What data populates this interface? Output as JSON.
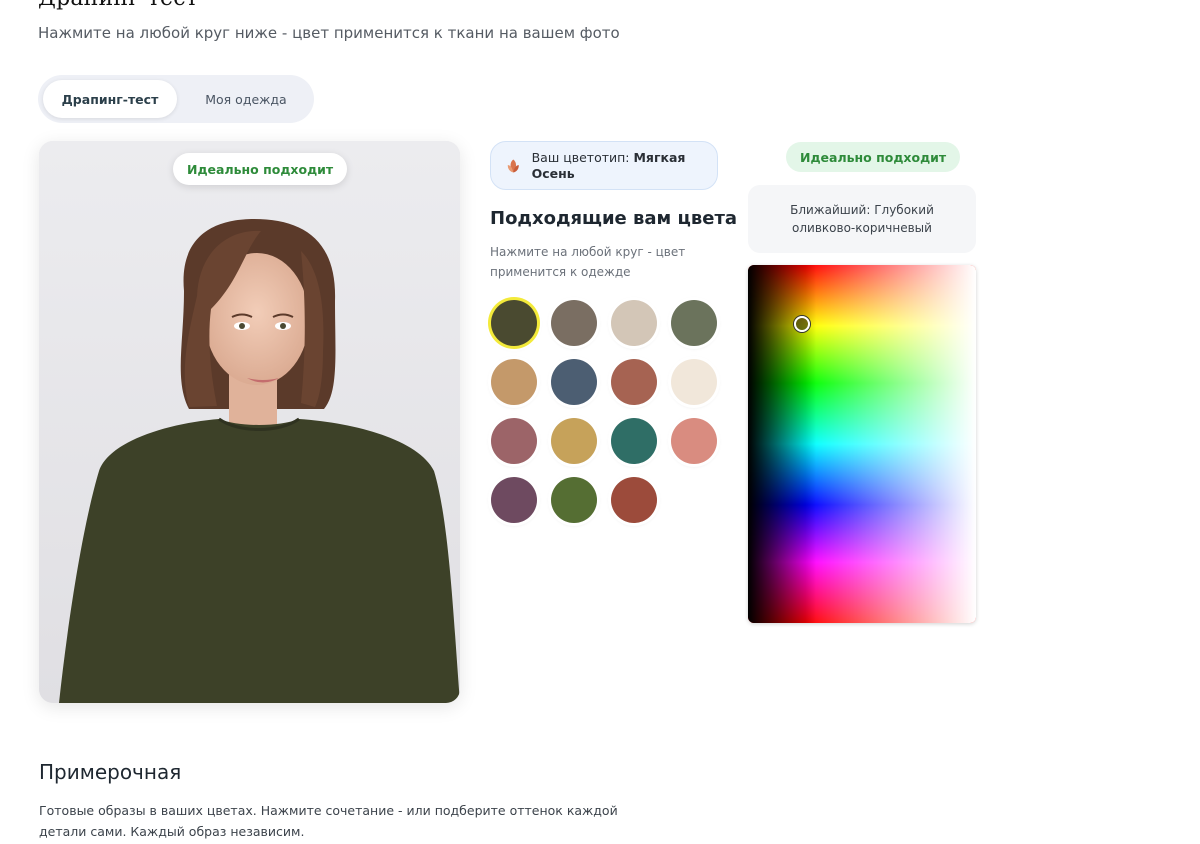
{
  "header": {
    "title_cut": "Драпинг-тест",
    "subtitle": "Нажмите на любой круг ниже - цвет применится к ткани на вашем фото"
  },
  "tabs": [
    {
      "label": "Драпинг-тест",
      "active": true
    },
    {
      "label": "Моя одежда",
      "active": false
    }
  ],
  "photo": {
    "fit_badge": "Идеально подходит",
    "fabric_color": "#3d4128"
  },
  "colortype": {
    "prefix": "Ваш цветотип: ",
    "value": "Мягкая Осень",
    "icon": "autumn-leaf-icon"
  },
  "palette": {
    "title": "Подходящие вам цвета",
    "hint": "Нажмите на любой круг - цвет применится к одежде",
    "selected_index": 0,
    "swatches": [
      "#4a4a30",
      "#7a6e62",
      "#d3c6b7",
      "#6b735c",
      "#c4996a",
      "#4c5e72",
      "#a66352",
      "#f1e7da",
      "#9c6468",
      "#c6a25a",
      "#2f6e66",
      "#d98c80",
      "#6e4a60",
      "#556e33",
      "#9c4b3b"
    ]
  },
  "picker": {
    "fit_badge": "Идеально подходит",
    "nearest": "Ближайший: Глубокий оливково-коричневый"
  },
  "fitting": {
    "title": "Примерочная",
    "description": "Готовые образы в ваших цветах. Нажмите сочетание - или подберите оттенок каждой детали сами. Каждый образ независим."
  }
}
